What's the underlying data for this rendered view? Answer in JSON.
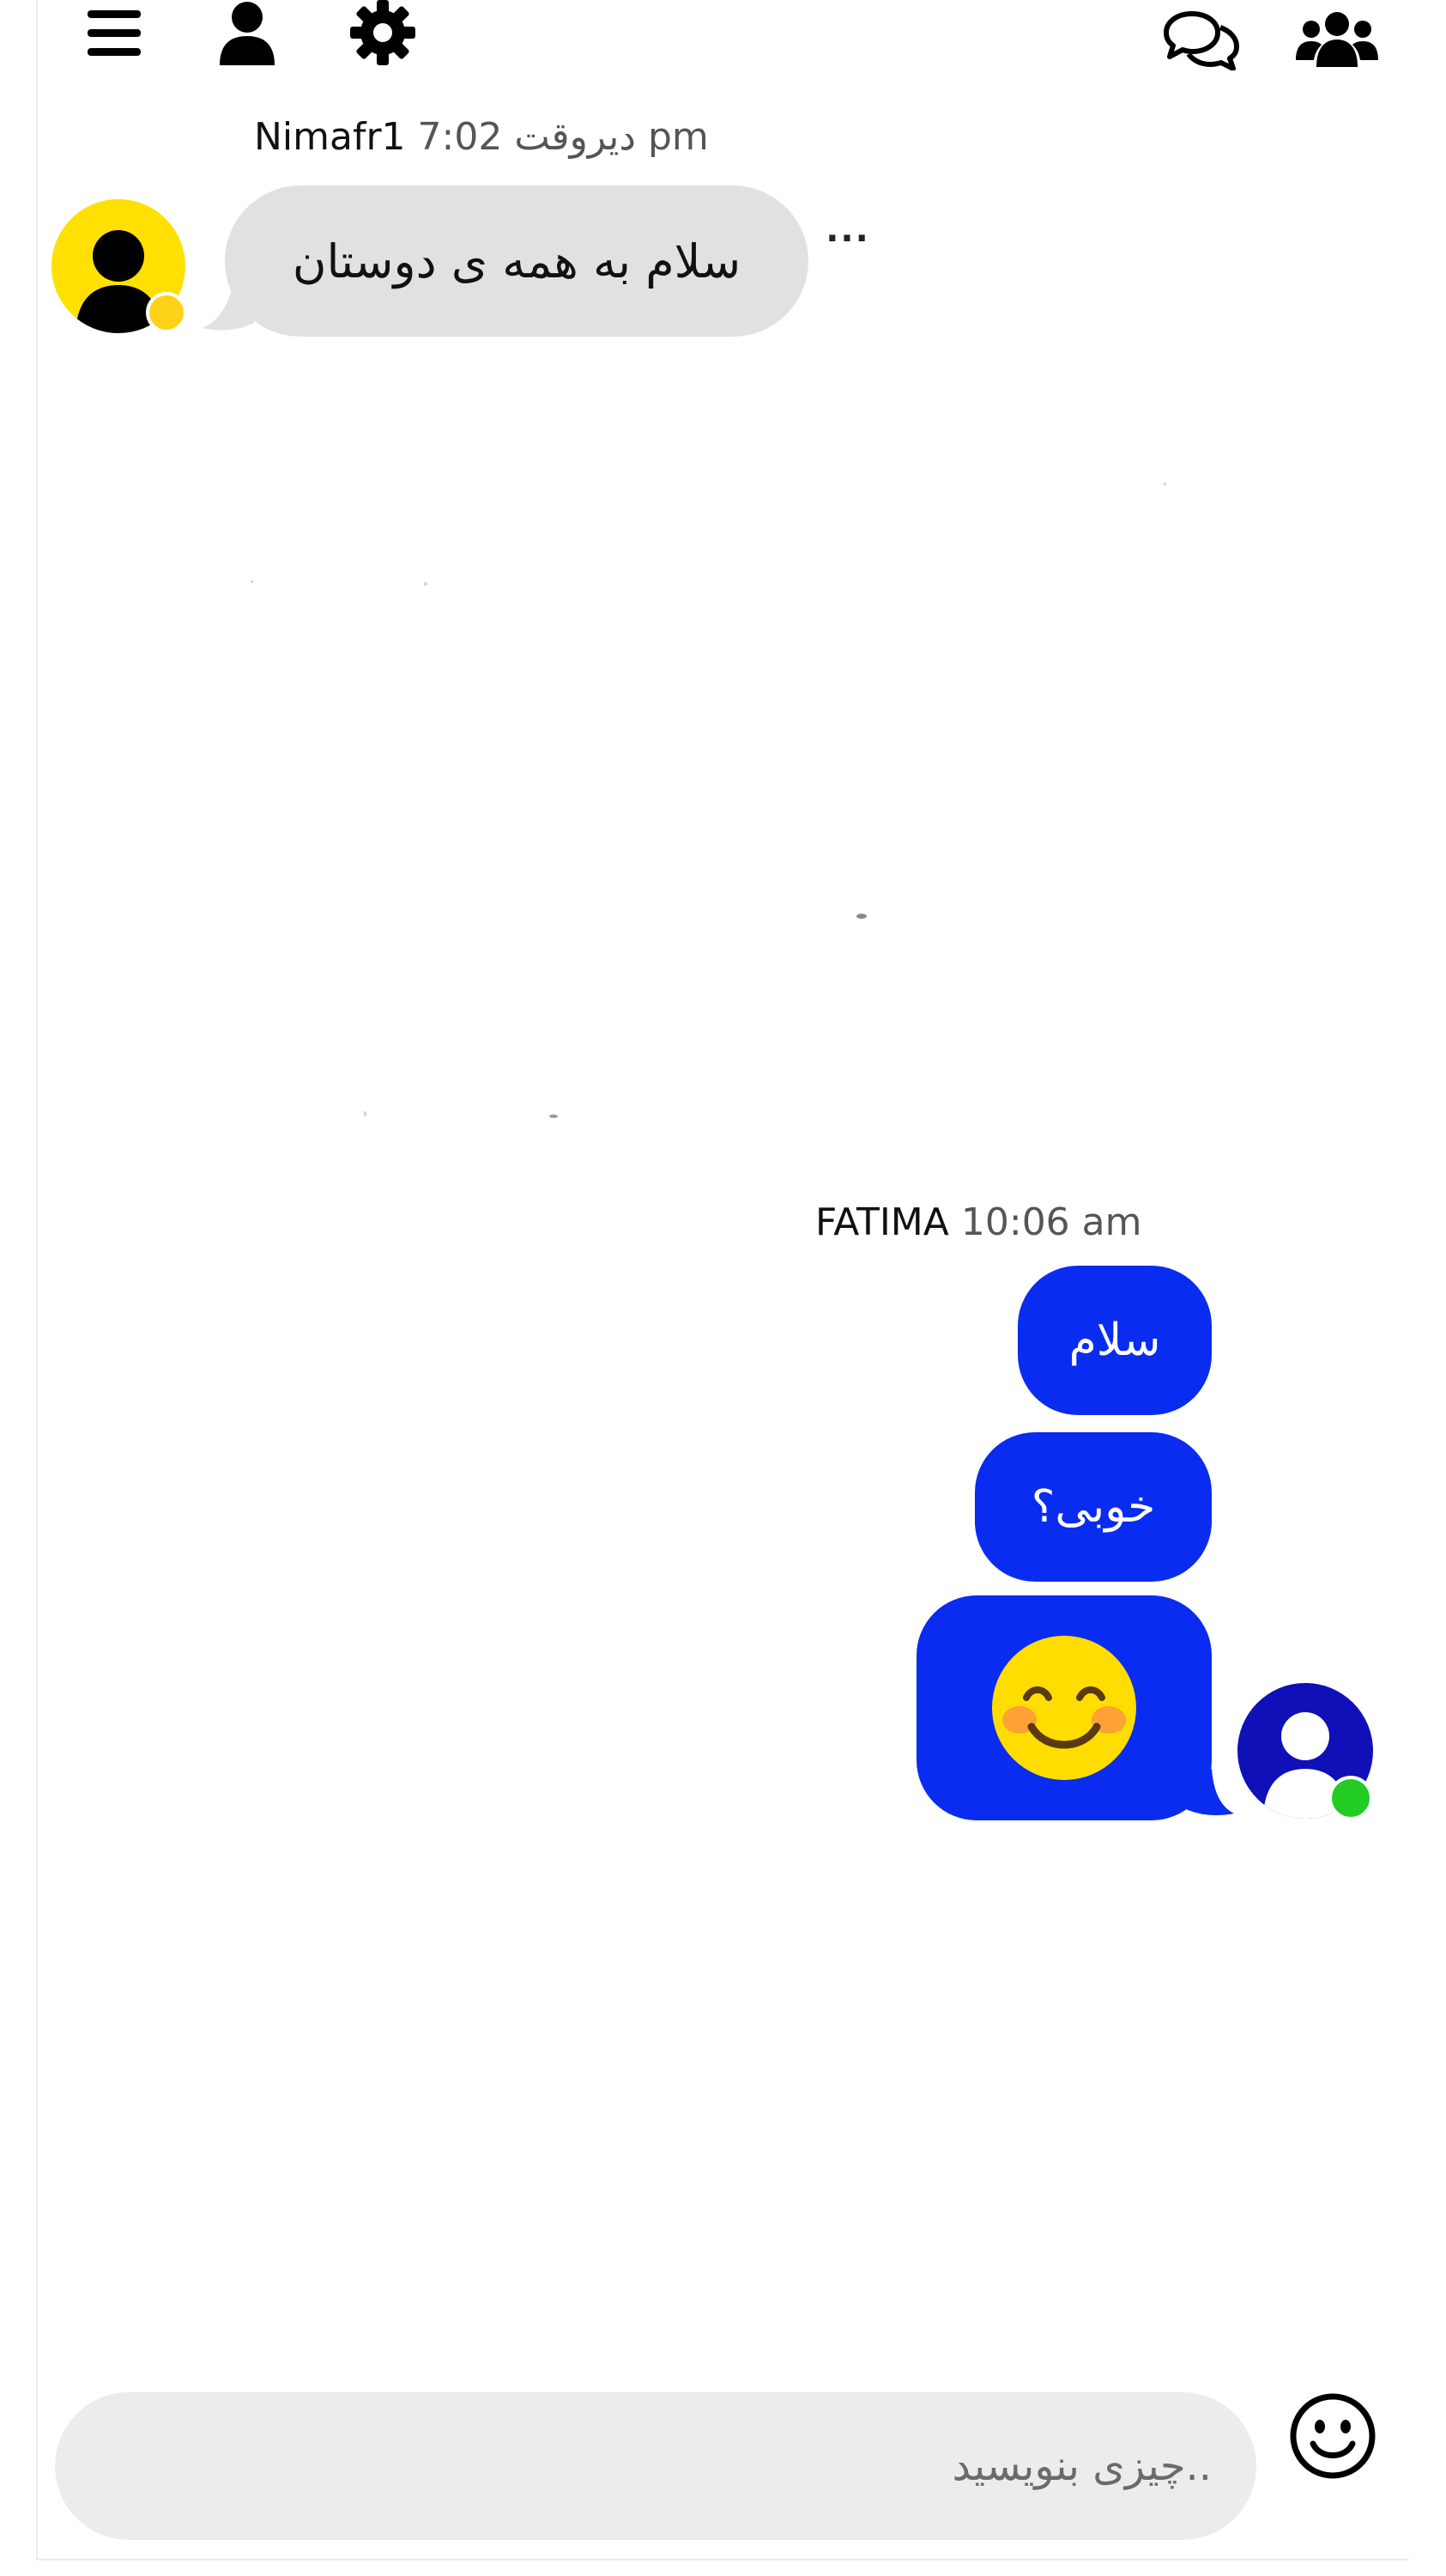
{
  "topbar": {
    "left_icons": [
      "menu-icon",
      "user-icon",
      "settings-icon"
    ],
    "right_icons": [
      "chats-icon",
      "group-icon"
    ]
  },
  "messages": [
    {
      "user": "Nimafr1",
      "time": "7:02 دیروقت pm",
      "direction": "incoming",
      "bubble_color": "#e1e1e1",
      "avatar_color": "#ffe000",
      "status_color": "#ffd21a",
      "texts": [
        "سلام به همه ی دوستان"
      ],
      "more_label": "..."
    },
    {
      "user": "FATIMA",
      "time": "10:06 am",
      "direction": "outgoing",
      "bubble_color": "#0a2cf0",
      "avatar_color": "#1010b8",
      "status_color": "#22cc22",
      "texts": [
        "سلام",
        "خوبی؟"
      ],
      "emoji": "smiling-face-icon"
    }
  ],
  "composer": {
    "placeholder": "..چیزی بنویسید",
    "value": ""
  },
  "composer_emoji_icon": "emoji-icon"
}
